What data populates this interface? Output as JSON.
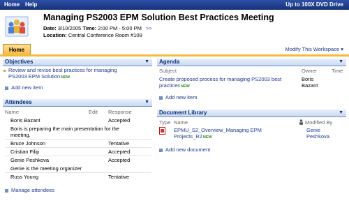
{
  "topbar": {
    "home": "Home",
    "help": "Help",
    "site": "Up to 100X DVD Drive"
  },
  "meeting": {
    "title": "Managing PS2003 EPM Solution Best Practices Meeting",
    "date_label": "Date:",
    "date": "3/10/2005",
    "time_label": "Time:",
    "time": "2:00 PM - 5:00 PM",
    "more": ">>",
    "location_label": "Location:",
    "location": "Central Conference Room #109"
  },
  "tabs": {
    "home": "Home",
    "modify": "Modify This Workspace ▾"
  },
  "objectives": {
    "title": "Objectives",
    "items": [
      {
        "line1": "Review and revise best practices for managing",
        "line2": "PS2003 EPM Solution",
        "new": "NEW"
      }
    ],
    "add": "Add new item"
  },
  "attendees": {
    "title": "Attendees",
    "columns": {
      "name": "Name",
      "edit": "Edit",
      "response": "Response"
    },
    "rows": [
      {
        "name": "Boris Bazant",
        "response": "Accepted"
      },
      {
        "note1": "Boris is preparing the main presentation for the",
        "note2": "meeting."
      },
      {
        "name": "Bruce Johnson",
        "response": "Tentative"
      },
      {
        "name": "Cristian Filip",
        "response": "Accepted"
      },
      {
        "name": "Genie Peshkova",
        "response": "Accepted"
      },
      {
        "note1": "Genie is the meeting organizer"
      },
      {
        "name": "Russ Young",
        "response": "Tentative"
      }
    ],
    "manage": "Manage attendees"
  },
  "agenda": {
    "title": "Agenda",
    "columns": {
      "subject": "Subject",
      "owner": "Owner",
      "time": "Time"
    },
    "rows": [
      {
        "line1": "Create proposed process for managing PS2003 best",
        "line2": "practices",
        "new": "NEW",
        "owner1": "Boris",
        "owner2": "Bazant"
      }
    ],
    "add": "Add new item"
  },
  "documents": {
    "title": "Document Library",
    "columns": {
      "type": "Type",
      "name": "Name",
      "modified": "Modified By"
    },
    "rows": [
      {
        "line1": "EPMU_S2_Overview_Managing EPM",
        "line2": "Projects_R2",
        "new": "NEW",
        "mod1": "Genie",
        "mod2": "Peshkova"
      }
    ],
    "add": "Add new document"
  }
}
